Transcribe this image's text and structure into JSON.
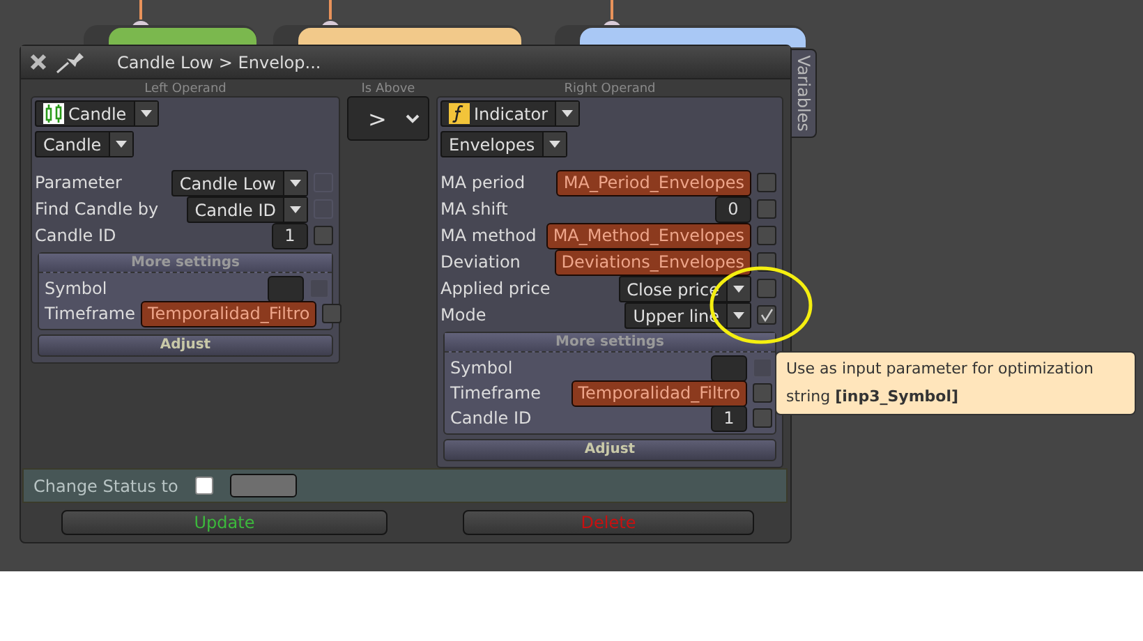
{
  "background_nodes": [
    {
      "color": "#7bb84e"
    },
    {
      "color": "#f2c98a"
    },
    {
      "color": "#a9c8f5"
    }
  ],
  "dialog": {
    "title": "Candle Low > Envelop...",
    "left_operand": {
      "heading": "Left Operand",
      "type_select": {
        "kind": "candle",
        "value": "Candle"
      },
      "subtype": "Candle",
      "rows": [
        {
          "label": "Parameter",
          "kind": "select",
          "value": "Candle Low",
          "checked": false,
          "disabled": true
        },
        {
          "label": "Find Candle by",
          "kind": "select",
          "value": "Candle ID",
          "checked": false,
          "disabled": true
        },
        {
          "label": "Candle ID",
          "kind": "number",
          "value": "1",
          "checked": false,
          "disabled": false
        }
      ],
      "more_settings": {
        "heading": "More settings",
        "rows": [
          {
            "label": "Symbol",
            "kind": "empty",
            "checked": false,
            "disabled": true
          },
          {
            "label": "Timeframe",
            "kind": "variable",
            "value": "Temporalidad_Filtro",
            "checked": false,
            "disabled": false
          }
        ]
      },
      "adjust": "Adjust"
    },
    "comparator": {
      "heading": "Is Above",
      "value": ">"
    },
    "right_operand": {
      "heading": "Right Operand",
      "type_select": {
        "kind": "function",
        "value": "Indicator"
      },
      "subtype": "Envelopes",
      "rows": [
        {
          "label": "MA period",
          "kind": "variable",
          "value": "MA_Period_Envelopes",
          "checked": false,
          "disabled": false
        },
        {
          "label": "MA shift",
          "kind": "number",
          "value": "0",
          "checked": false,
          "disabled": false
        },
        {
          "label": "MA method",
          "kind": "variable",
          "value": "MA_Method_Envelopes",
          "checked": false,
          "disabled": false
        },
        {
          "label": "Deviation",
          "kind": "variable",
          "value": "Deviations_Envelopes",
          "checked": false,
          "disabled": false
        },
        {
          "label": "Applied price",
          "kind": "select",
          "value": "Close price",
          "checked": false,
          "disabled": false
        },
        {
          "label": "Mode",
          "kind": "select",
          "value": "Upper line",
          "checked": true,
          "disabled": false
        }
      ],
      "more_settings": {
        "heading": "More settings",
        "rows": [
          {
            "label": "Symbol",
            "kind": "empty",
            "checked": false,
            "disabled": true
          },
          {
            "label": "Timeframe",
            "kind": "variable",
            "value": "Temporalidad_Filtro",
            "checked": false,
            "disabled": false
          },
          {
            "label": "Candle ID",
            "kind": "number",
            "value": "1",
            "checked": false,
            "disabled": false
          }
        ]
      },
      "adjust": "Adjust"
    },
    "change_status": {
      "label": "Change Status to",
      "checked": false
    },
    "buttons": [
      {
        "label": "Update",
        "kind": "update"
      },
      {
        "label": "Delete",
        "kind": "delete"
      }
    ]
  },
  "side_tab": "Variables",
  "tooltip": {
    "text": "Use as input parameter for optimization string **[inp3_Symbol]**"
  }
}
